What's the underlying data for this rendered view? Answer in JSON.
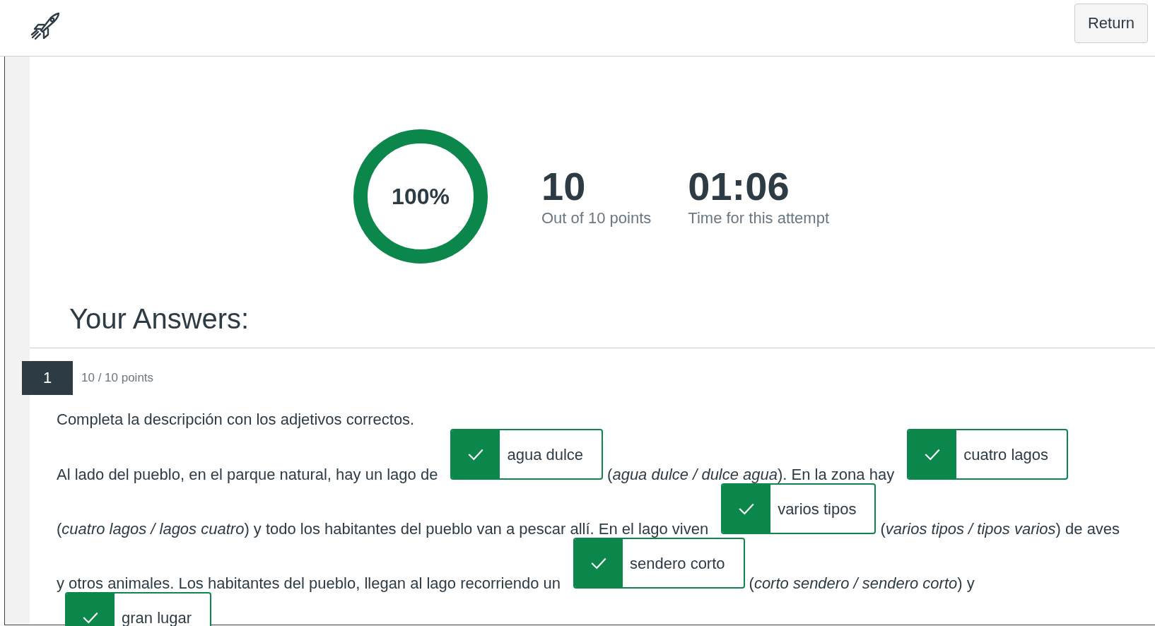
{
  "header": {
    "return_button": "Return"
  },
  "score": {
    "percent": "100%",
    "level": 1,
    "points": "10",
    "points_label": "Out of 10 points",
    "time": "01:06",
    "time_label": "Time for this attempt"
  },
  "answers_heading": "Your Answers:",
  "questions": [
    {
      "number": "1",
      "points": "10 / 10 points",
      "instruction": "Completa la descripción con los adjetivos correctos.",
      "passage": [
        {
          "kind": "text",
          "text": "Al lado del pueblo, en el parque natural, hay un lago de"
        },
        {
          "kind": "answer",
          "value": "agua dulce",
          "correct": true
        },
        {
          "kind": "text",
          "text": "(*agua dulce / dulce agua*). En la zona hay"
        },
        {
          "kind": "answer",
          "value": "cuatro lagos",
          "correct": true
        },
        {
          "kind": "text",
          "text": "(*cuatro lagos / lagos cuatro*) y todo los habitantes del pueblo van a pescar allí. En el lago viven"
        },
        {
          "kind": "answer",
          "value": "varios tipos",
          "correct": true
        },
        {
          "kind": "text",
          "text": "(*varios tipos / tipos varios*) de aves"
        },
        {
          "kind": "text",
          "text": "y otros animales. Los habitantes  del pueblo, llegan al lago recorriendo un"
        },
        {
          "kind": "answer",
          "value": "sendero corto",
          "correct": true
        },
        {
          "kind": "text",
          "text": "(*corto sendero / sendero corto*) y"
        },
        {
          "kind": "answer",
          "value": "gran lugar",
          "correct": true
        }
      ]
    }
  ]
}
